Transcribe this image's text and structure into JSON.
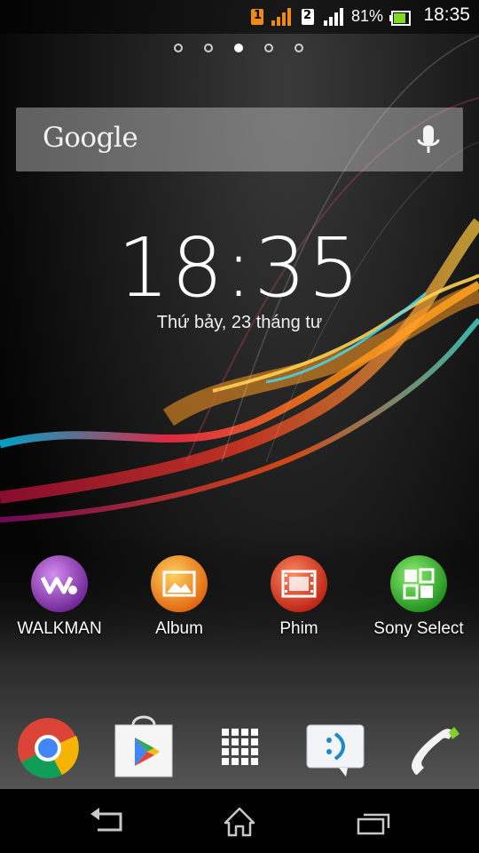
{
  "status_bar": {
    "sim1_label": "1",
    "sim2_label": "2",
    "battery_percent": "81%",
    "battery_level": 0.81,
    "time": "18:35",
    "icons": [
      "sim1-icon",
      "signal-icon-sim1",
      "sim2-icon",
      "signal-icon-sim2",
      "battery-icon"
    ]
  },
  "home_pages": {
    "count": 5,
    "active_index": 2
  },
  "search_widget": {
    "logo_text": "Google",
    "mic_icon": "mic-icon"
  },
  "clock_widget": {
    "time": "18:35",
    "date": "Thứ bảy, 23 tháng tư"
  },
  "apps": [
    {
      "label": "WALKMAN",
      "icon": "walkman-icon",
      "color": "#8e3bb8"
    },
    {
      "label": "Album",
      "icon": "album-icon",
      "color": "#f08a12"
    },
    {
      "label": "Phim",
      "icon": "movies-icon",
      "color": "#d9381e"
    },
    {
      "label": "Sony Select",
      "icon": "sony-select-icon",
      "color": "#2fa82f"
    }
  ],
  "dock": [
    {
      "name": "chrome",
      "icon": "chrome-icon"
    },
    {
      "name": "play-store",
      "icon": "play-store-icon"
    },
    {
      "name": "app-drawer",
      "icon": "app-drawer-icon"
    },
    {
      "name": "messaging",
      "icon": "messaging-icon"
    },
    {
      "name": "phone",
      "icon": "phone-icon"
    }
  ],
  "nav_bar": {
    "icons": [
      "back-icon",
      "home-icon",
      "recents-icon"
    ]
  }
}
